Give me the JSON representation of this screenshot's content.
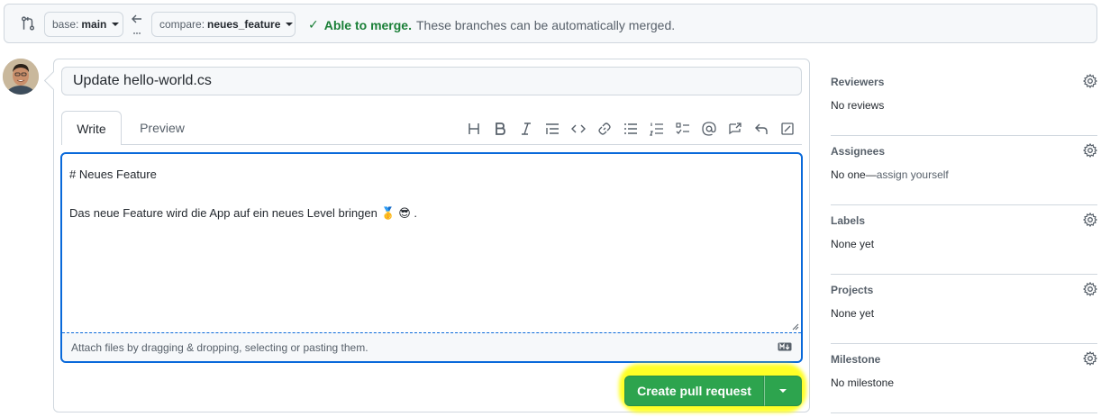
{
  "compare": {
    "base_prefix": "base:",
    "base_branch": "main",
    "compare_prefix": "compare:",
    "compare_branch": "neues_feature",
    "merge_status_ok": "Able to merge.",
    "merge_status_text": "These branches can be automatically merged.",
    "status_color": "#1a7f37"
  },
  "pr": {
    "title_value": "Update hello-world.cs",
    "tabs": [
      {
        "label": "Write",
        "active": true
      },
      {
        "label": "Preview",
        "active": false
      }
    ],
    "toolbar_icons": [
      "heading-icon",
      "bold-icon",
      "italic-icon",
      "quote-icon",
      "code-icon",
      "link-icon",
      "bulleted-list-icon",
      "numbered-list-icon",
      "task-list-icon",
      "mention-icon",
      "cross-reference-icon",
      "reply-icon",
      "fullscreen-icon"
    ],
    "body_line1": "# Neues Feature",
    "body_line2": "Das neue Feature wird die App auf ein neues Level bringen 🥇 😎 .",
    "attach_hint": "Attach files by dragging & dropping, selecting or pasting them.",
    "submit_label": "Create pull request",
    "submit_color": "#2da44e",
    "highlight_color": "#ffff00"
  },
  "sidebar": {
    "sections": [
      {
        "title": "Reviewers",
        "value": "No reviews",
        "suffix": ""
      },
      {
        "title": "Assignees",
        "value": "No one—",
        "suffix": "assign yourself"
      },
      {
        "title": "Labels",
        "value": "None yet",
        "suffix": ""
      },
      {
        "title": "Projects",
        "value": "None yet",
        "suffix": ""
      },
      {
        "title": "Milestone",
        "value": "No milestone",
        "suffix": ""
      }
    ]
  }
}
